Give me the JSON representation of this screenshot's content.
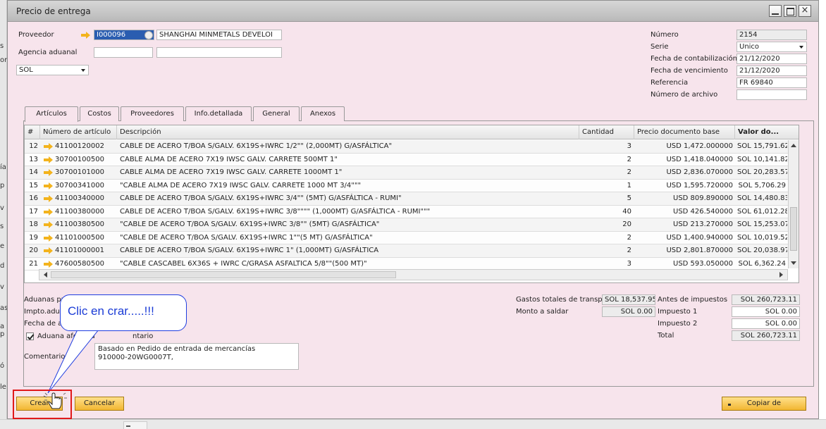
{
  "window": {
    "title": "Precio de entrega"
  },
  "header_left": {
    "proveedor_label": "Proveedor",
    "proveedor_code": "I000096",
    "proveedor_name": "SHANGHAI MINMETALS DEVELOI",
    "agencia_label": "Agencia aduanal",
    "agencia_code": "",
    "agencia_name": "",
    "currency": "SOL"
  },
  "header_right": {
    "numero_label": "Número",
    "numero_value": "2154",
    "serie_label": "Serie",
    "serie_value": "Unico",
    "fecha_contab_label": "Fecha de contabilización",
    "fecha_contab_value": "21/12/2020",
    "fecha_venc_label": "Fecha de vencimiento",
    "fecha_venc_value": "21/12/2020",
    "referencia_label": "Referencia",
    "referencia_value": "FR 69840",
    "num_archivo_label": "Número de archivo",
    "num_archivo_value": ""
  },
  "tabs": [
    "Artículos",
    "Costos",
    "Proveedores",
    "Info.detallada",
    "General",
    "Anexos"
  ],
  "grid": {
    "columns": [
      "#",
      "Número de artículo",
      "Descripción",
      "Cantidad",
      "Precio documento base",
      "Valor do..."
    ],
    "rows": [
      {
        "n": "12",
        "art": "41100120002",
        "desc": "CABLE DE ACERO T/BOA S/GALV. 6X19S+IWRC 1/2\"\" (2,000MT) G/ASFÁLTICA\"",
        "qty": "3",
        "price": "USD 1,472.000000",
        "val": "SOL 15,791.62"
      },
      {
        "n": "13",
        "art": "30700100500",
        "desc": "CABLE ALMA DE ACERO 7X19 IWSC GALV. CARRETE 500MT 1\"",
        "qty": "2",
        "price": "USD 1,418.040000",
        "val": "SOL 10,141.82"
      },
      {
        "n": "14",
        "art": "30700101000",
        "desc": "CABLE ALMA DE ACERO 7X19 IWSC GALV. CARRETE 1000MT 1\"",
        "qty": "2",
        "price": "USD 2,836.070000",
        "val": "SOL 20,283.57"
      },
      {
        "n": "15",
        "art": "30700341000",
        "desc": "\"CABLE ALMA DE ACERO 7X19 IWSC GALV. CARRETE  1000 MT  3/4\"\"\"",
        "qty": "1",
        "price": "USD 1,595.720000",
        "val": "SOL 5,706.29"
      },
      {
        "n": "16",
        "art": "41100340000",
        "desc": "CABLE DE ACERO T/BOA S/GALV. 6X19S+IWRC 3/4\"\" (5MT) G/ASFÁLTICA - RUMI\"",
        "qty": "5",
        "price": "USD 809.890000",
        "val": "SOL 14,480.83"
      },
      {
        "n": "17",
        "art": "41100380000",
        "desc": "CABLE DE ACERO T/BOA S/GALV. 6X19S+IWRC 3/8\"\"\"\" (1,000MT) G/ASFÁLTICA - RUMI\"\"\"",
        "qty": "40",
        "price": "USD 426.540000",
        "val": "SOL 61,012.28"
      },
      {
        "n": "18",
        "art": "41100380500",
        "desc": "\"CABLE DE ACERO T/BOA S/GALV. 6X19S+IWRC 3/8\"\" (5MT) G/ASFÁLTICA\"",
        "qty": "20",
        "price": "USD 213.270000",
        "val": "SOL 15,253.07"
      },
      {
        "n": "19",
        "art": "41101000500",
        "desc": "\"CABLE DE ACERO T/BOA S/GALV. 6X19S+IWRC 1\"\"(5 MT) G/ASFÁLTICA\"",
        "qty": "2",
        "price": "USD 1,400.940000",
        "val": "SOL 10,019.52"
      },
      {
        "n": "20",
        "art": "41101000001",
        "desc": "CABLE DE ACERO T/BOA S/GALV. 6X19S+IWRC 1\" (1,000MT) G/ASFÁLTICA",
        "qty": "2",
        "price": "USD 2,801.870000",
        "val": "SOL 20,038.97"
      },
      {
        "n": "21",
        "art": "47600580500",
        "desc": "\"CABLE CASCABEL 6X36S + IWRC C/GRASA ASFALTICA 5/8\"\"(500 MT)\"",
        "qty": "3",
        "price": "USD 593.050000",
        "val": "SOL 6,362.24"
      }
    ]
  },
  "footer_left": {
    "aduanas_label": "Aduanas pr",
    "impto_label": "Impto.adua",
    "fecha_label": "Fecha de ac",
    "aduana_afecta_label": "Aduana afecta a",
    "aduana_afecta_tail": "ntario",
    "comentarios_label": "Comentarios",
    "comentarios_line1": "Basado en Pedido de entrada de mercancías",
    "comentarios_line2": "910000-20WG0007T,"
  },
  "footer_mid": {
    "gastos_label": "Gastos totales de transp",
    "gastos_value": "SOL 18,537.95",
    "monto_label": "Monto a saldar",
    "monto_value": "SOL 0.00"
  },
  "footer_right": {
    "antes_label": "Antes de impuestos",
    "antes_value": "SOL 260,723.11",
    "imp1_label": "Impuesto 1",
    "imp1_value": "SOL 0.00",
    "imp2_label": "Impuesto 2",
    "imp2_value": "SOL 0.00",
    "total_label": "Total",
    "total_value": "SOL 260,723.11"
  },
  "buttons": {
    "crear": "Crear",
    "cancelar": "Cancelar",
    "copiar_de": "Copiar de"
  },
  "callout": {
    "text": "Clic en crar.....!!!"
  },
  "background": {
    "left_letters": [
      "s",
      "or",
      "ía",
      "p",
      "v",
      "s",
      "e",
      "d",
      "v",
      "as",
      "a p",
      "ó",
      "le"
    ]
  }
}
